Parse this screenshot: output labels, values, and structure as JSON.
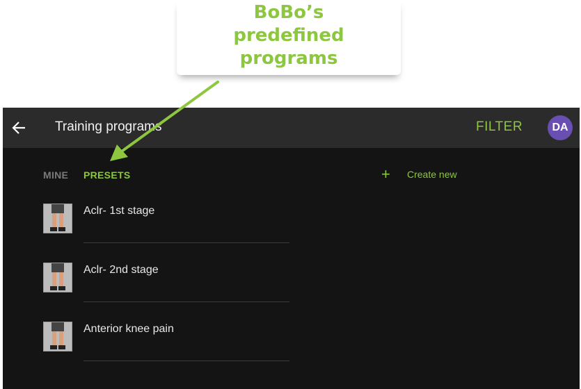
{
  "callout": {
    "text": "BoBo’s predefined programs"
  },
  "topbar": {
    "back_icon": "arrow-left-icon",
    "title": "Training programs",
    "filter_label": "FILTER",
    "avatar_initials": "DA"
  },
  "tabs": [
    {
      "label": "MINE",
      "active": false
    },
    {
      "label": "PRESETS",
      "active": true
    }
  ],
  "create": {
    "icon": "plus-icon",
    "label": "Create new"
  },
  "programs": [
    {
      "name": "Aclr- 1st stage",
      "thumb_icon": "legs-thumbnail-icon"
    },
    {
      "name": "Aclr- 2nd stage",
      "thumb_icon": "legs-thumbnail-icon"
    },
    {
      "name": "Anterior knee pain",
      "thumb_icon": "legs-thumbnail-icon"
    }
  ],
  "colors": {
    "accent_green": "#8dc63f",
    "topbar_bg": "#2b2b2b",
    "content_bg": "#141414",
    "avatar_purple": "#6a4fb3",
    "inactive_tab": "#7a7a7a"
  }
}
